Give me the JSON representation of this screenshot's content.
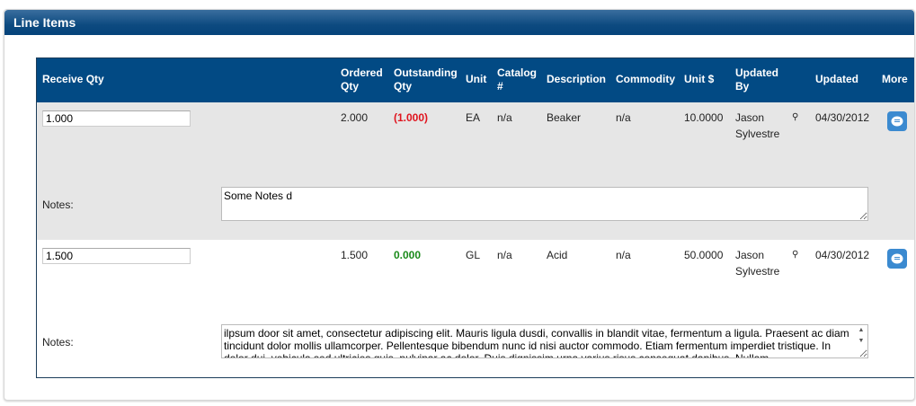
{
  "panel": {
    "title": "Line Items"
  },
  "columns": {
    "receive_qty": "Receive Qty",
    "ordered_qty_1": "Ordered",
    "ordered_qty_2": "Qty",
    "outstanding_1": "Outstanding",
    "outstanding_2": "Qty",
    "unit": "Unit",
    "catalog_1": "Catalog",
    "catalog_2": "#",
    "description": "Description",
    "commodity": "Commodity",
    "unit_price": "Unit $",
    "updated_by_1": "Updated",
    "updated_by_2": "By",
    "updated": "Updated",
    "more": "More"
  },
  "colors": {
    "negative": "#e0141e",
    "positive": "#1a8a1a",
    "header": "#024a84",
    "more_button": "#3b8ad0"
  },
  "rows": [
    {
      "receive_qty": "1.000",
      "ordered_qty": "2.000",
      "outstanding_qty": "(1.000)",
      "unit": "EA",
      "catalog": "n/a",
      "description": "Beaker",
      "commodity": "n/a",
      "unit_price": "10.0000",
      "updated_by_1": "Jason",
      "updated_by_2": "Sylvestre",
      "updated": "04/30/2012",
      "notes_label": "Notes:",
      "notes": "Some Notes d"
    },
    {
      "receive_qty": "1.500",
      "ordered_qty": "1.500",
      "outstanding_qty": "0.000",
      "unit": "GL",
      "catalog": "n/a",
      "description": "Acid",
      "commodity": "n/a",
      "unit_price": "50.0000",
      "updated_by_1": "Jason",
      "updated_by_2": "Sylvestre",
      "updated": "04/30/2012",
      "notes_label": "Notes:",
      "notes": "ilpsum door sit amet, consectetur adipiscing elit. Mauris ligula dusdi, convallis in blandit vitae, fermentum a ligula. Praesent ac diam tincidunt dolor mollis ullamcorper. Pellentesque bibendum nunc id nisi auctor commodo. Etiam fermentum imperdiet tristique. In dolor dui, vehicula sed ultricies quis, pulvinar ac dolor. Duis dignissim urna varius risus consequat dapibus. Nullam"
    }
  ]
}
